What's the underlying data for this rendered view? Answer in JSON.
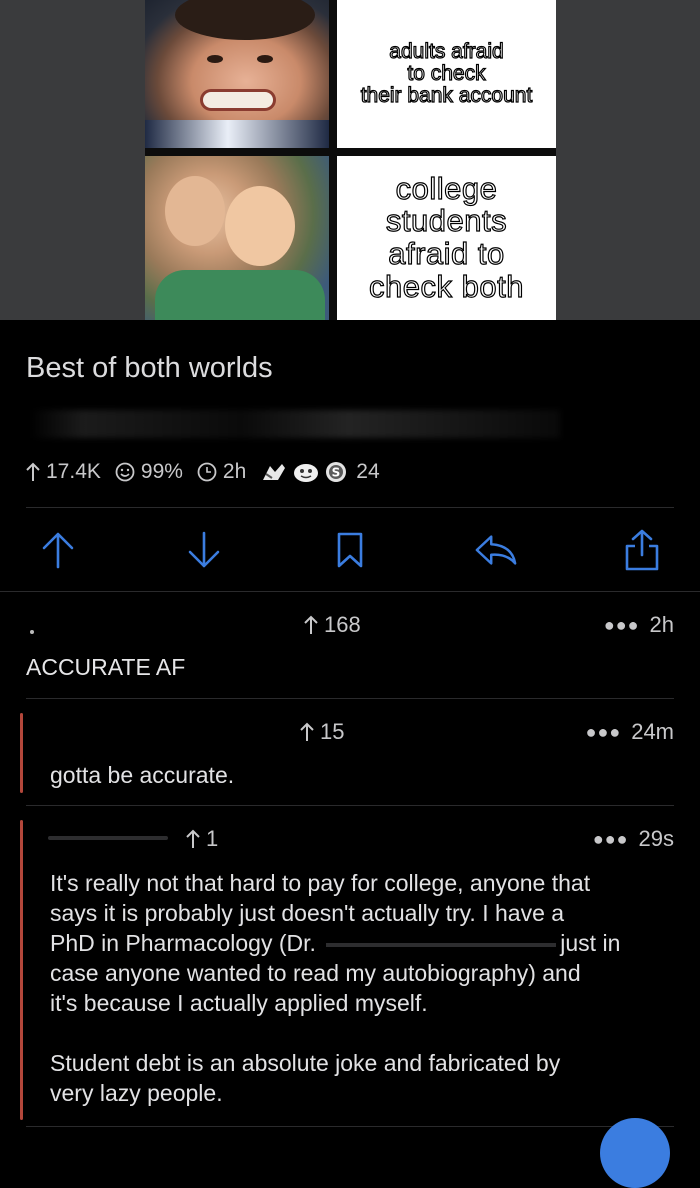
{
  "meme": {
    "top_text": [
      "adults afraid",
      "to check",
      "their bank account"
    ],
    "bottom_text": [
      "college",
      "students",
      "afraid to",
      "check both"
    ]
  },
  "post": {
    "title": "Best of both worlds",
    "upvotes": "17.4K",
    "upvote_ratio": "99%",
    "age": "2h",
    "award_count": "24"
  },
  "comments": [
    {
      "votes": "168",
      "age": "2h",
      "body": "ACCURATE AF"
    },
    {
      "votes": "15",
      "age": "24m",
      "body": "gotta be accurate."
    },
    {
      "votes": "1",
      "age": "29s",
      "paragraph1_lines": [
        "It's really not that hard to pay for college, anyone that",
        "says it is probably just doesn't actually try. I have a",
        "PhD in Pharmacology (Dr.",
        "case anyone wanted to read my autobiography) and",
        "it's because I actually applied myself."
      ],
      "line3_tail": "just in",
      "paragraph2_lines": [
        "Student debt is an absolute joke and fabricated by",
        "very lazy people."
      ]
    }
  ],
  "colors": {
    "background": "#000000",
    "accent_blue": "#3b7de0",
    "thread_line": "#b3473b",
    "text": "#d7d7d9"
  }
}
